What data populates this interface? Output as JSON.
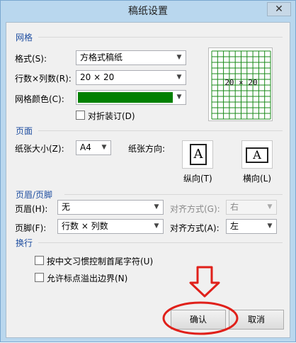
{
  "dialog": {
    "title": "稿纸设置",
    "close_glyph": "✕"
  },
  "grid_section": {
    "title": "网格",
    "format_label": "格式(S):",
    "format_value": "方格式稿纸",
    "rowcol_label": "行数×列数(R):",
    "rowcol_value": "20 × 20",
    "color_label": "网格颜色(C):",
    "color_value": "#008000",
    "fold_label": "对折装订(D)",
    "preview_text": "20 × 20"
  },
  "page_section": {
    "title": "页面",
    "size_label": "纸张大小(Z):",
    "size_value": "A4",
    "orientation_label": "纸张方向:",
    "portrait_label": "纵向(T)",
    "landscape_label": "横向(L)",
    "orientation_glyph": "A"
  },
  "header_footer_section": {
    "title": "页眉/页脚",
    "header_label": "页眉(H):",
    "header_value": "无",
    "header_align_label": "对齐方式(G):",
    "header_align_value": "右",
    "footer_label": "页脚(F):",
    "footer_value": "行数 × 列数",
    "footer_align_label": "对齐方式(A):",
    "footer_align_value": "左"
  },
  "wrap_section": {
    "title": "换行",
    "option1_label": "按中文习惯控制首尾字符(U)",
    "option2_label": "允许标点溢出边界(N)"
  },
  "buttons": {
    "ok_label": "确认",
    "cancel_label": "取消"
  },
  "annotation": {
    "color": "#e0201a"
  },
  "icons": {
    "dropdown": "chevron-down-icon",
    "close": "close-icon",
    "annotation_arrow": "red-down-arrow",
    "annotation_circle": "red-circle-highlight"
  }
}
